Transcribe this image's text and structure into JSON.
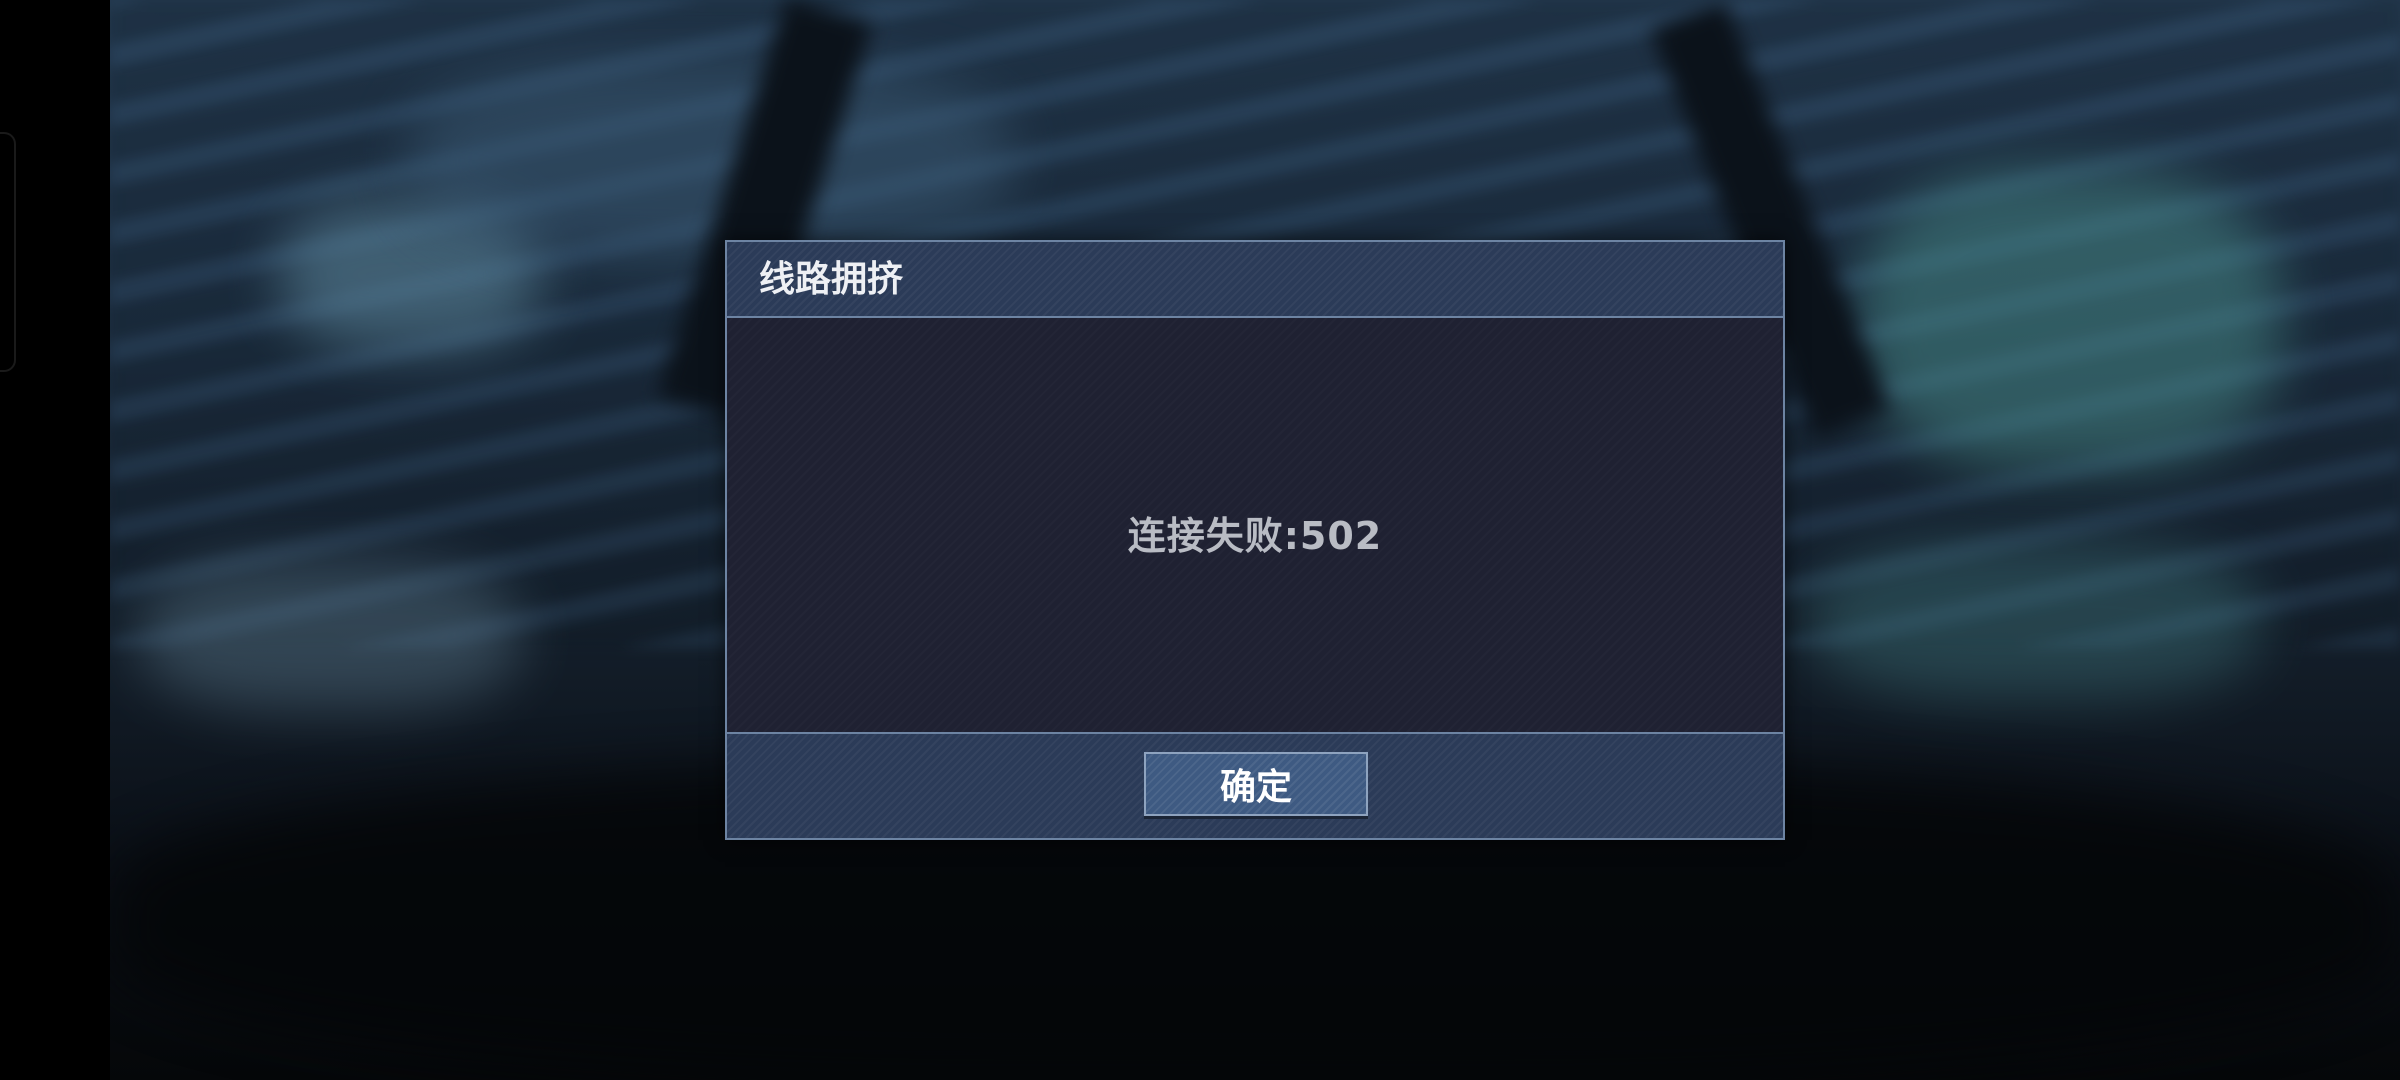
{
  "dialog": {
    "title": "线路拥挤",
    "message": "连接失败:502",
    "confirm_label": "确定"
  },
  "colors": {
    "dialog_border": "#6d84a3",
    "header_bg": "#2b3b58",
    "body_bg": "#1f2132",
    "button_bg": "#3e5a82"
  }
}
